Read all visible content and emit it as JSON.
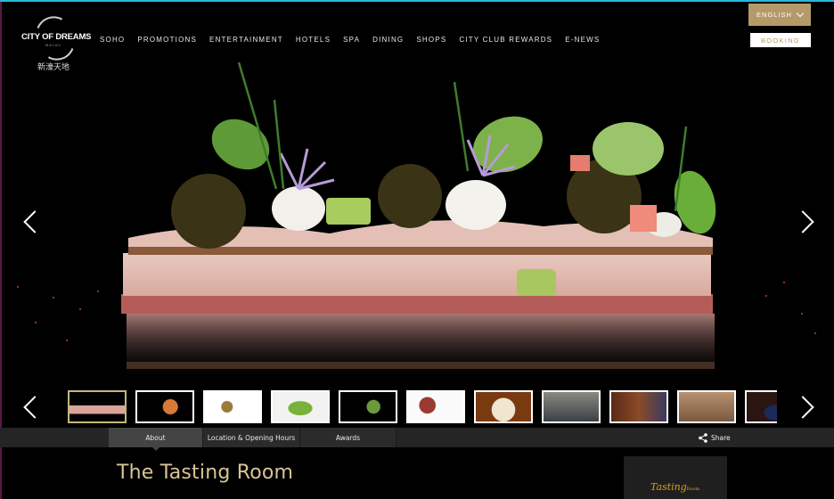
{
  "header": {
    "logo": {
      "name": "CITY OF DREAMS",
      "sub": "MACAU",
      "chinese": "新濠天地"
    },
    "nav": [
      "SOHO",
      "PROMOTIONS",
      "ENTERTAINMENT",
      "HOTELS",
      "SPA",
      "DINING",
      "SHOPS",
      "CITY CLUB REWARDS",
      "E-NEWS"
    ],
    "language": "ENGLISH",
    "booking": "BOOKING"
  },
  "gallery": {
    "prev_icon": "chevron-left-icon",
    "next_icon": "chevron-right-icon",
    "active_index": 0,
    "thumbnails": [
      "layered lobster dish with caviar",
      "dish on black plate",
      "white plate with garnish",
      "green puree dish",
      "dish on dark background",
      "sliced meat with sauce",
      "salad on white plate",
      "dining room interior",
      "private dining room",
      "wine cellar",
      "sommelier portrait"
    ]
  },
  "tabs": [
    {
      "label": "About",
      "active": true
    },
    {
      "label": "Location & Opening Hours",
      "active": false
    },
    {
      "label": "Awards",
      "active": false
    }
  ],
  "share_label": "Share",
  "page_title": "The Tasting Room",
  "sidecard": {
    "brand": "Tasting",
    "brand_suffix": "Room"
  },
  "colors": {
    "gold": "#b49a68",
    "title": "#d9c594",
    "accent_line": "#2bb7da"
  }
}
